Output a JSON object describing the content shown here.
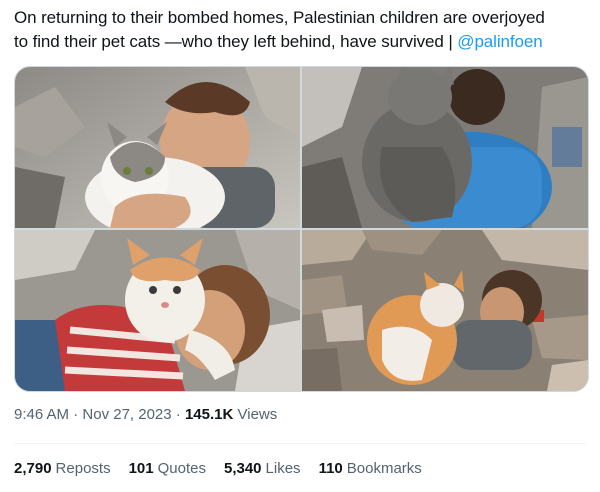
{
  "tweet": {
    "text_line1": "On returning to their bombed homes, Palestinian children are overjoyed",
    "text_line2": "to find their pet cats —who they left behind, have survived | ",
    "mention": "@palinfoen"
  },
  "media": {
    "images": [
      {
        "icon": "child-hugging-white-cat-photo"
      },
      {
        "icon": "child-in-blue-hugging-gray-cat-photo"
      },
      {
        "icon": "child-hugging-orange-cat-photo"
      },
      {
        "icon": "child-with-orange-cat-in-rubble-photo"
      }
    ]
  },
  "meta": {
    "time": "9:46 AM",
    "separator": "·",
    "date": "Nov 27, 2023",
    "views_count": "145.1K",
    "views_label": "Views"
  },
  "stats": [
    {
      "count": "2,790",
      "label": "Reposts"
    },
    {
      "count": "101",
      "label": "Quotes"
    },
    {
      "count": "5,340",
      "label": "Likes"
    },
    {
      "count": "110",
      "label": "Bookmarks"
    }
  ],
  "colors": {
    "link": "#1d9bf0",
    "text": "#0f1419",
    "secondary": "#536471",
    "border": "#cfd9de"
  }
}
